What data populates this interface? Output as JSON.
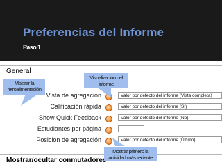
{
  "header": {
    "title": "Preferencias del Informe",
    "step": "Paso 1"
  },
  "sections": {
    "general": "General",
    "toggle": "Mostrar/ocultar conmutadores"
  },
  "rows": [
    {
      "label": "Vista de agregación",
      "value": "Valor por defecto del informe (Vista completa)"
    },
    {
      "label": "Calificación rápida",
      "value": "Valor por defecto del informe (Sí)"
    },
    {
      "label": "Show Quick Feedback",
      "value": "Valor por defecto del informe (No)"
    },
    {
      "label": "Estudiantes por página",
      "value": ""
    },
    {
      "label": "Posición de agregación",
      "value": "Valor por defecto del informe (Último)"
    }
  ],
  "callouts": {
    "feedback": "Mostrar la retroalimentación",
    "visualization": "Visualización del informe",
    "activity": "Mostrar primero la actividad más reciente"
  },
  "colors": {
    "header_bg": "#1a1a1a",
    "title": "#6f94d6",
    "callout_bg": "#9fbeed",
    "help_icon": "#f08a2c"
  }
}
